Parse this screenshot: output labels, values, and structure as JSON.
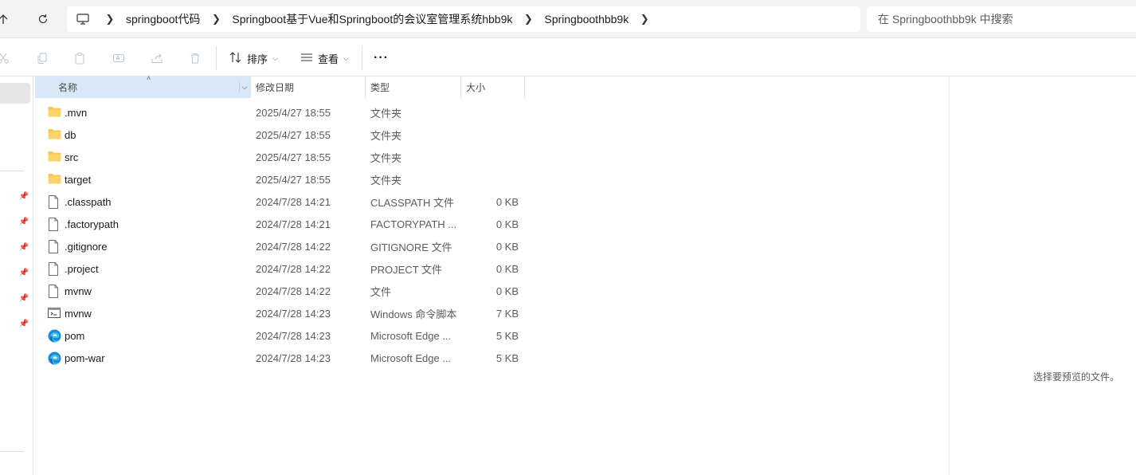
{
  "address": {
    "breadcrumbs": [
      "springboot代码",
      "Springboot基于Vue和Springboot的会议室管理系统hbb9k",
      "Springboothbb9k"
    ],
    "search_placeholder": "在 Springboothbb9k 中搜索"
  },
  "toolbar": {
    "sort_label": "排序",
    "view_label": "查看",
    "more_label": "···"
  },
  "columns": {
    "name": "名称",
    "date": "修改日期",
    "type": "类型",
    "size": "大小"
  },
  "files": [
    {
      "name": ".mvn",
      "date": "2025/4/27 18:55",
      "type": "文件夹",
      "size": "",
      "icon": "folder-icon"
    },
    {
      "name": "db",
      "date": "2025/4/27 18:55",
      "type": "文件夹",
      "size": "",
      "icon": "folder-icon"
    },
    {
      "name": "src",
      "date": "2025/4/27 18:55",
      "type": "文件夹",
      "size": "",
      "icon": "folder-icon"
    },
    {
      "name": "target",
      "date": "2025/4/27 18:55",
      "type": "文件夹",
      "size": "",
      "icon": "folder-icon"
    },
    {
      "name": ".classpath",
      "date": "2024/7/28 14:21",
      "type": "CLASSPATH 文件",
      "size": "0 KB",
      "icon": "file-icon"
    },
    {
      "name": ".factorypath",
      "date": "2024/7/28 14:21",
      "type": "FACTORYPATH ...",
      "size": "0 KB",
      "icon": "file-icon"
    },
    {
      "name": ".gitignore",
      "date": "2024/7/28 14:22",
      "type": "GITIGNORE 文件",
      "size": "0 KB",
      "icon": "file-icon"
    },
    {
      "name": ".project",
      "date": "2024/7/28 14:22",
      "type": "PROJECT 文件",
      "size": "0 KB",
      "icon": "file-icon"
    },
    {
      "name": "mvnw",
      "date": "2024/7/28 14:22",
      "type": "文件",
      "size": "0 KB",
      "icon": "file-icon"
    },
    {
      "name": "mvnw",
      "date": "2024/7/28 14:23",
      "type": "Windows 命令脚本",
      "size": "7 KB",
      "icon": "cmd-script-icon"
    },
    {
      "name": "pom",
      "date": "2024/7/28 14:23",
      "type": "Microsoft Edge ...",
      "size": "5 KB",
      "icon": "edge-icon"
    },
    {
      "name": "pom-war",
      "date": "2024/7/28 14:23",
      "type": "Microsoft Edge ...",
      "size": "5 KB",
      "icon": "edge-icon"
    }
  ],
  "preview": {
    "message": "选择要预览的文件。"
  }
}
